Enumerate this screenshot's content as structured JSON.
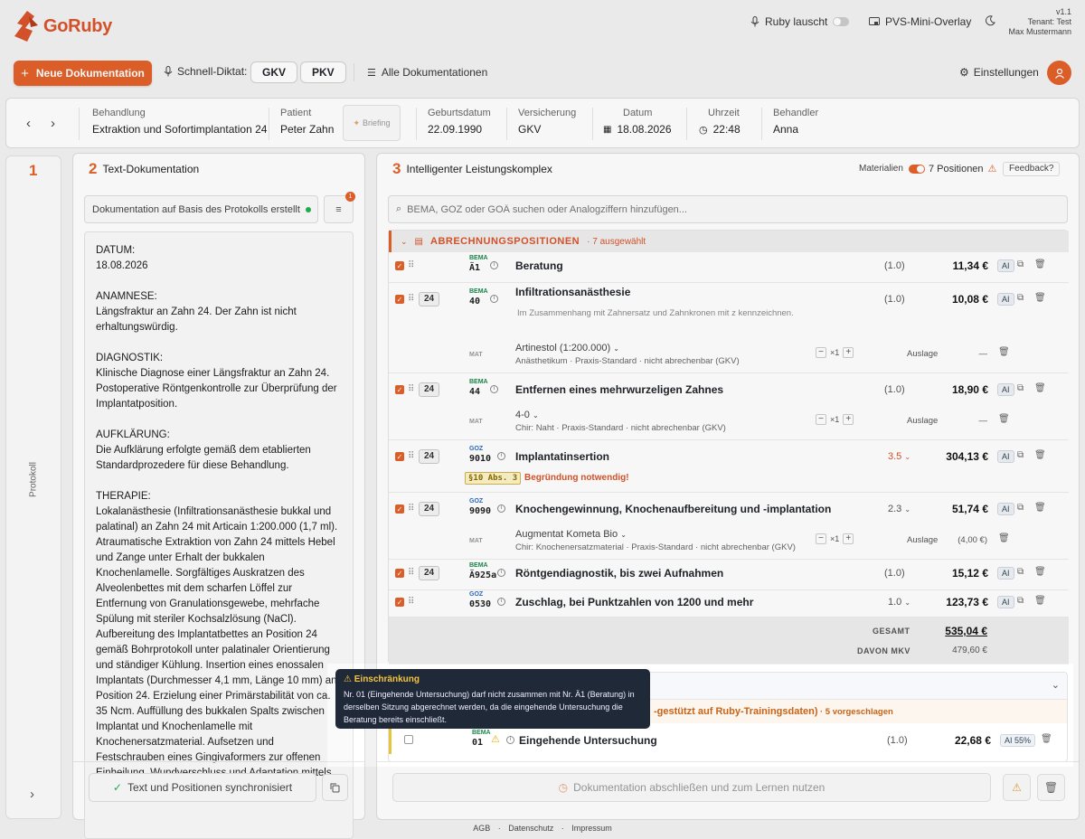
{
  "app": {
    "name": "GoRuby",
    "version": "v1.1",
    "tenant": "Tenant: Test",
    "user": "Max Mustermann"
  },
  "header": {
    "ruby_listen": "Ruby lauscht",
    "pvs_overlay": "PVS-Mini-Overlay"
  },
  "toolbar": {
    "new_doc": "Neue Dokumentation",
    "quick_dictation": "Schnell-Diktat:",
    "gkv": "GKV",
    "pkv": "PKV",
    "all_docs": "Alle Dokumentationen",
    "settings": "Einstellungen"
  },
  "patient": {
    "behandlung_label": "Behandlung",
    "behandlung": "Extraktion und Sofortimplantation 24",
    "patient_label": "Patient",
    "patient": "Peter Zahn",
    "briefing": "Briefing",
    "geburtsdatum_label": "Geburtsdatum",
    "geburtsdatum": "22.09.1990",
    "versicherung_label": "Versicherung",
    "versicherung": "GKV",
    "datum_label": "Datum",
    "datum": "18.08.2026",
    "uhrzeit_label": "Uhrzeit",
    "uhrzeit": "22:48",
    "behandler_label": "Behandler",
    "behandler": "Anna"
  },
  "rail": {
    "num": "1",
    "label": "Protokoll",
    "expand": "›"
  },
  "text_panel": {
    "num": "2",
    "title": "Text-Dokumentation",
    "source_select": "Dokumentation auf Basis des Protokolls erstellt",
    "filter_badge": "1",
    "sync_label": "Text und Positionen synchronisiert",
    "doc": "DATUM:\n18.08.2026\n\nANAMNESE:\nLängsfraktur an Zahn 24. Der Zahn ist nicht erhaltungswürdig.\n\nDIAGNOSTIK:\nKlinische Diagnose einer Längsfraktur an Zahn 24. Postoperative Röntgenkontrolle zur Überprüfung der Implantatposition.\n\nAUFKLÄRUNG:\nDie Aufklärung erfolgte gemäß dem etablierten Standardprozedere für diese Behandlung.\n\nTHERAPIE:\nLokalanästhesie (Infiltrationsanästhesie bukkal und palatinal) an Zahn 24 mit Articain 1:200.000 (1,7 ml). Atraumatische Extraktion von Zahn 24 mittels Hebel und Zange unter Erhalt der bukkalen Knochenlamelle. Sorgfältiges Auskratzen des Alveolenbettes mit dem scharfen Löffel zur Entfernung von Granulationsgewebe, mehrfache Spülung mit steriler Kochsalzlösung (NaCl).\nAufbereitung des Implantatbettes an Position 24 gemäß Bohrprotokoll unter palatinaler Orientierung und ständiger Kühlung. Insertion eines enossalen Implantats (Durchmesser 4,1 mm, Länge 10 mm) an Position 24. Erzielung einer Primärstabilität von ca. 35 Ncm. Auffüllung des bukkalen Spalts zwischen Implantat und Knochenlamelle mit Knochenersatzmaterial. Aufsetzen und Festschrauben eines Gingivaformers zur offenen Einheilung. Wundverschluss und Adaptation mittels"
  },
  "perf_panel": {
    "num": "3",
    "title": "Intelligenter Leistungskomplex",
    "materials": "Materialien",
    "positions": "7 Positionen",
    "feedback": "Feedback?",
    "search_placeholder": "BEMA, GOZ oder GOÄ suchen oder Analogziffern hinzufügen...",
    "section_title": "ABRECHNUNGSPOSITIONEN",
    "section_count": "· 7 ausgewählt",
    "gesamt_label": "GESAMT",
    "gesamt": "535,04 €",
    "mkv_label": "DAVON MKV",
    "mkv": "479,60 €",
    "suggest_title": "-gestützt auf Ruby-Trainingsdaten)",
    "suggest_count": "· 5 vorgeschlagen",
    "finish": "Dokumentation abschließen und zum Lernen nutzen"
  },
  "rows": [
    {
      "tooth": "",
      "kind": "BEMA",
      "code": "Ä1",
      "desc": "Beratung",
      "factor": "(1.0)",
      "price": "11,34 €",
      "ai": "AI"
    },
    {
      "tooth": "24",
      "kind": "BEMA",
      "code": "40",
      "desc": "Infiltrationsanästhesie",
      "sub": "Im Zusammenhang mit Zahnersatz und Zahnkronen mit z kennzeichnen.",
      "factor": "(1.0)",
      "price": "10,08 €",
      "ai": "AI",
      "mat": {
        "label": "MAT",
        "name": "Artinestol (1:200.000)",
        "sub": "Anästhetikum · Praxis-Standard · nicht abrechenbar (GKV)",
        "qty": "×1",
        "auslage": "Auslage",
        "price": "—"
      }
    },
    {
      "tooth": "24",
      "kind": "BEMA",
      "code": "44",
      "desc": "Entfernen eines mehrwurzeligen Zahnes",
      "factor": "(1.0)",
      "price": "18,90 €",
      "ai": "AI",
      "mat": {
        "label": "MAT",
        "name": "4-0",
        "sub": "Chir: Naht · Praxis-Standard · nicht abrechenbar (GKV)",
        "qty": "×1",
        "auslage": "Auslage",
        "price": "—"
      }
    },
    {
      "tooth": "24",
      "kind": "GOZ",
      "code": "9010",
      "desc": "Implantatinsertion",
      "factor": "3.5",
      "price": "304,13 €",
      "ai": "AI",
      "par": "§10 Abs. 3",
      "begr": "Begründung notwendig!"
    },
    {
      "tooth": "24",
      "kind": "GOZ",
      "code": "9090",
      "desc": "Knochengewinnung, Knochenaufbereitung und -implantation",
      "factor": "2.3",
      "price": "51,74 €",
      "ai": "AI",
      "mat": {
        "label": "MAT",
        "name": "Augmentat Kometa Bio",
        "sub": "Chir: Knochenersatzmaterial · Praxis-Standard · nicht abrechenbar (GKV)",
        "qty": "×1",
        "auslage": "Auslage",
        "price": "(4,00 €)"
      }
    },
    {
      "tooth": "24",
      "kind": "BEMA",
      "code": "Ä925a",
      "desc": "Röntgendiagnostik, bis zwei Aufnahmen",
      "factor": "(1.0)",
      "price": "15,12 €",
      "ai": "AI"
    },
    {
      "tooth": "",
      "kind": "GOZ",
      "code": "0530",
      "desc": "Zuschlag, bei Punktzahlen von 1200 und mehr",
      "factor": "1.0",
      "price": "123,73 €",
      "ai": "AI"
    }
  ],
  "suggest_row": {
    "kind": "BEMA",
    "code": "01",
    "desc": "Eingehende Untersuchung",
    "factor": "(1.0)",
    "price": "22,68 €",
    "ai": "AI 55%"
  },
  "tooltip": {
    "title": "⚠ Einschränkung",
    "body": "Nr. 01 (Eingehende Untersuchung) darf nicht zusammen mit Nr. Ä1 (Beratung) in derselben Sitzung abgerechnet werden, da die eingehende Untersuchung die Beratung bereits einschließt."
  },
  "footer": {
    "agb": "AGB",
    "datenschutz": "Datenschutz",
    "impressum": "Impressum"
  },
  "colors": {
    "accent": "#e3622b",
    "bema": "#1b8a4e",
    "goz": "#2d6cc4"
  }
}
